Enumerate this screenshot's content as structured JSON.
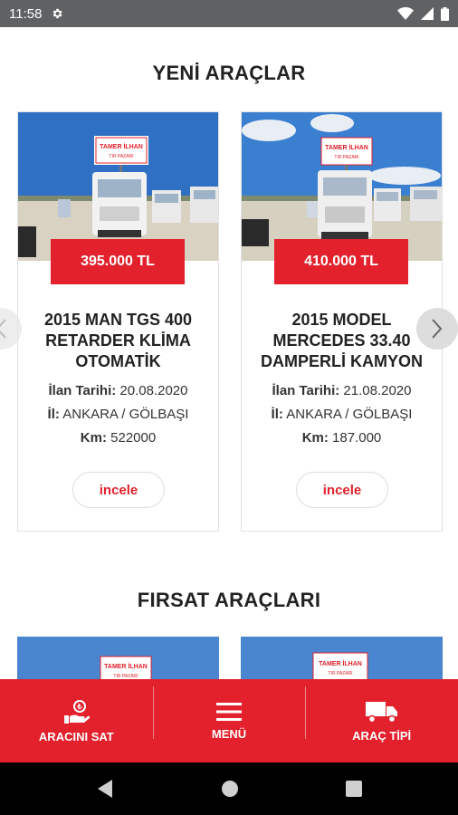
{
  "status_bar": {
    "time": "11:58"
  },
  "sections": {
    "new_title": "YENİ ARAÇLAR",
    "deals_title": "FIRSAT ARAÇLARI"
  },
  "cards": [
    {
      "price": "395.000 TL",
      "title": "2015 MAN TGS 400 RETARDER KLİMA OTOMATİK",
      "date_label": "İlan Tarihi:",
      "date": "20.08.2020",
      "city_label": "İl:",
      "city": "ANKARA / GÖLBAŞI",
      "km_label": "Km:",
      "km": "522000",
      "button": "incele"
    },
    {
      "price": "410.000 TL",
      "title": "2015 MODEL MERCEDES 33.40 DAMPERLİ KAMYON",
      "date_label": "İlan Tarihi:",
      "date": "21.08.2020",
      "city_label": "İl:",
      "city": "ANKARA / GÖLBAŞI",
      "km_label": "Km:",
      "km": "187.000",
      "button": "incele"
    }
  ],
  "photo_sign": {
    "line1": "TAMER İLHAN",
    "line2": "TIR PAZARI"
  },
  "bottom_nav": [
    {
      "label": "ARACINI SAT",
      "icon": "sell-hand-icon"
    },
    {
      "label": "MENÜ",
      "icon": "hamburger-menu-icon"
    },
    {
      "label": "ARAÇ TİPİ",
      "icon": "truck-icon"
    }
  ],
  "colors": {
    "accent": "#e2212c",
    "statusbar": "#5f6163"
  }
}
